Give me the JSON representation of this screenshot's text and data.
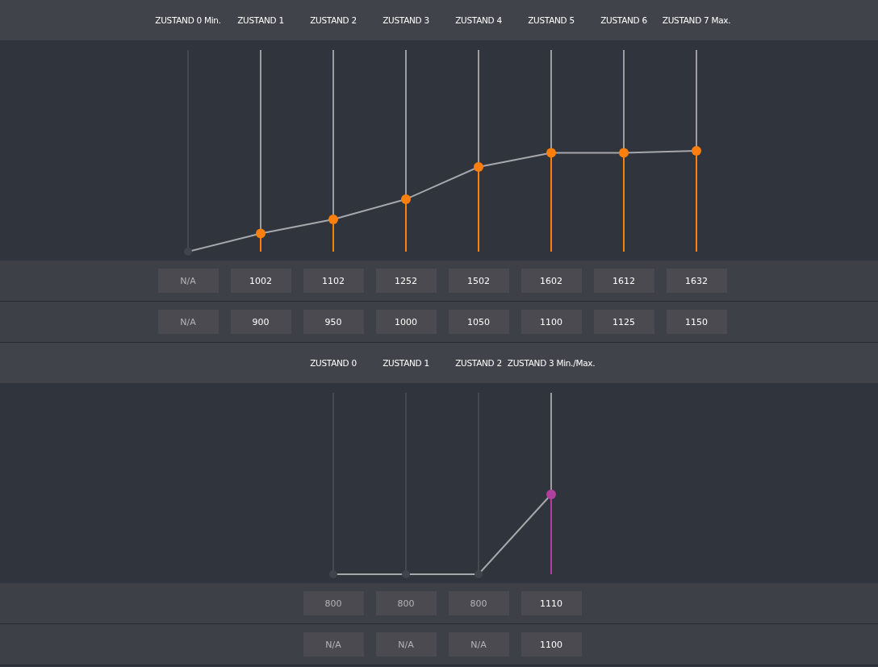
{
  "sections": [
    {
      "color": "#ff7f0e",
      "states": [
        {
          "label": "ZUSTAND 0 Min.",
          "disabled": true,
          "level": 0,
          "values": [
            "N/A",
            "N/A"
          ]
        },
        {
          "label": "ZUSTAND 1",
          "disabled": false,
          "level": 0.09,
          "values": [
            "1002",
            "900"
          ]
        },
        {
          "label": "ZUSTAND 2",
          "disabled": false,
          "level": 0.16,
          "values": [
            "1102",
            "950"
          ]
        },
        {
          "label": "ZUSTAND 3",
          "disabled": false,
          "level": 0.26,
          "values": [
            "1252",
            "1000"
          ]
        },
        {
          "label": "ZUSTAND 4",
          "disabled": false,
          "level": 0.42,
          "values": [
            "1502",
            "1050"
          ]
        },
        {
          "label": "ZUSTAND 5",
          "disabled": false,
          "level": 0.49,
          "values": [
            "1602",
            "1100"
          ]
        },
        {
          "label": "ZUSTAND 6",
          "disabled": false,
          "level": 0.49,
          "values": [
            "1612",
            "1125"
          ]
        },
        {
          "label": "ZUSTAND 7 Max.",
          "disabled": false,
          "level": 0.5,
          "values": [
            "1632",
            "1150"
          ]
        }
      ]
    },
    {
      "color": "#b0409e",
      "states": [
        {
          "label": "ZUSTAND 0",
          "disabled": true,
          "level": 0,
          "values": [
            "800",
            "N/A"
          ]
        },
        {
          "label": "ZUSTAND 1",
          "disabled": true,
          "level": 0,
          "values": [
            "800",
            "N/A"
          ]
        },
        {
          "label": "ZUSTAND 2",
          "disabled": true,
          "level": 0,
          "values": [
            "800",
            "N/A"
          ]
        },
        {
          "label": "ZUSTAND 3 Min./Max.",
          "disabled": false,
          "level": 0.44,
          "values": [
            "1110",
            "1100"
          ]
        }
      ]
    }
  ]
}
